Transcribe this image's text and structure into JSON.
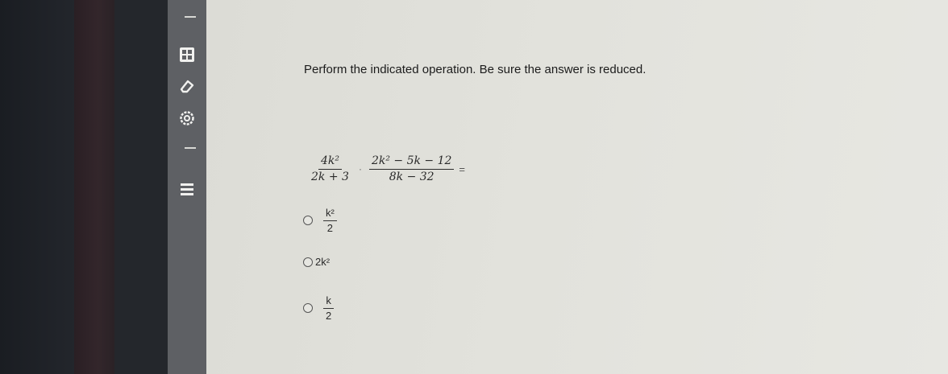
{
  "toolbar": {
    "icons": [
      "calculator-icon",
      "eraser-icon",
      "settings-gear-icon",
      "strike-icon"
    ]
  },
  "question": {
    "prompt": "Perform the indicated operation. Be sure the answer is reduced.",
    "expression": {
      "frac1_num": "4k²",
      "frac1_den": "2k + 3",
      "operator": "·",
      "frac2_num": "2k² − 5k − 12",
      "frac2_den": "8k − 32",
      "equals": "="
    },
    "options": [
      {
        "num": "k²",
        "den": "2"
      },
      {
        "text": "2k²"
      },
      {
        "num": "k",
        "den": "2"
      }
    ]
  }
}
